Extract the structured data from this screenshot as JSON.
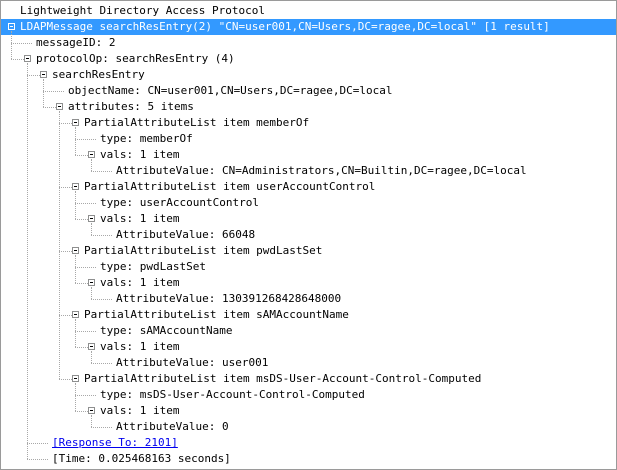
{
  "tree": {
    "rows": [
      {
        "text": "Lightweight Directory Access Protocol",
        "depth": 0,
        "expander": false,
        "selected": false,
        "link": false,
        "interactable": true
      },
      {
        "text": "LDAPMessage searchResEntry(2) \"CN=user001,CN=Users,DC=ragee,DC=local\" [1 result]",
        "depth": 0,
        "expander": true,
        "selected": true,
        "link": false,
        "interactable": true
      },
      {
        "text": "messageID: 2",
        "depth": 1,
        "expander": false,
        "selected": false,
        "link": false,
        "interactable": true
      },
      {
        "text": "protocolOp: searchResEntry (4)",
        "depth": 1,
        "expander": true,
        "selected": false,
        "link": false,
        "interactable": true
      },
      {
        "text": "searchResEntry",
        "depth": 2,
        "expander": true,
        "selected": false,
        "link": false,
        "interactable": true
      },
      {
        "text": "objectName: CN=user001,CN=Users,DC=ragee,DC=local",
        "depth": 3,
        "expander": false,
        "selected": false,
        "link": false,
        "interactable": true
      },
      {
        "text": "attributes: 5 items",
        "depth": 3,
        "expander": true,
        "selected": false,
        "link": false,
        "interactable": true
      },
      {
        "text": "PartialAttributeList item memberOf",
        "depth": 4,
        "expander": true,
        "selected": false,
        "link": false,
        "interactable": true
      },
      {
        "text": "type: memberOf",
        "depth": 5,
        "expander": false,
        "selected": false,
        "link": false,
        "interactable": true
      },
      {
        "text": "vals: 1 item",
        "depth": 5,
        "expander": true,
        "selected": false,
        "link": false,
        "interactable": true
      },
      {
        "text": "AttributeValue: CN=Administrators,CN=Builtin,DC=ragee,DC=local",
        "depth": 6,
        "expander": false,
        "selected": false,
        "link": false,
        "interactable": true
      },
      {
        "text": "PartialAttributeList item userAccountControl",
        "depth": 4,
        "expander": true,
        "selected": false,
        "link": false,
        "interactable": true
      },
      {
        "text": "type: userAccountControl",
        "depth": 5,
        "expander": false,
        "selected": false,
        "link": false,
        "interactable": true
      },
      {
        "text": "vals: 1 item",
        "depth": 5,
        "expander": true,
        "selected": false,
        "link": false,
        "interactable": true
      },
      {
        "text": "AttributeValue: 66048",
        "depth": 6,
        "expander": false,
        "selected": false,
        "link": false,
        "interactable": true
      },
      {
        "text": "PartialAttributeList item pwdLastSet",
        "depth": 4,
        "expander": true,
        "selected": false,
        "link": false,
        "interactable": true
      },
      {
        "text": "type: pwdLastSet",
        "depth": 5,
        "expander": false,
        "selected": false,
        "link": false,
        "interactable": true
      },
      {
        "text": "vals: 1 item",
        "depth": 5,
        "expander": true,
        "selected": false,
        "link": false,
        "interactable": true
      },
      {
        "text": "AttributeValue: 130391268428648000",
        "depth": 6,
        "expander": false,
        "selected": false,
        "link": false,
        "interactable": true
      },
      {
        "text": "PartialAttributeList item sAMAccountName",
        "depth": 4,
        "expander": true,
        "selected": false,
        "link": false,
        "interactable": true
      },
      {
        "text": "type: sAMAccountName",
        "depth": 5,
        "expander": false,
        "selected": false,
        "link": false,
        "interactable": true
      },
      {
        "text": "vals: 1 item",
        "depth": 5,
        "expander": true,
        "selected": false,
        "link": false,
        "interactable": true
      },
      {
        "text": "AttributeValue: user001",
        "depth": 6,
        "expander": false,
        "selected": false,
        "link": false,
        "interactable": true
      },
      {
        "text": "PartialAttributeList item msDS-User-Account-Control-Computed",
        "depth": 4,
        "expander": true,
        "selected": false,
        "link": false,
        "interactable": true
      },
      {
        "text": "type: msDS-User-Account-Control-Computed",
        "depth": 5,
        "expander": false,
        "selected": false,
        "link": false,
        "interactable": true
      },
      {
        "text": "vals: 1 item",
        "depth": 5,
        "expander": true,
        "selected": false,
        "link": false,
        "interactable": true
      },
      {
        "text": "AttributeValue: 0",
        "depth": 6,
        "expander": false,
        "selected": false,
        "link": false,
        "interactable": true
      },
      {
        "text": "[Response To: 2101]",
        "depth": 2,
        "expander": false,
        "selected": false,
        "link": true,
        "interactable": true
      },
      {
        "text": "[Time: 0.025468163 seconds]",
        "depth": 2,
        "expander": false,
        "selected": false,
        "link": false,
        "interactable": true
      }
    ]
  },
  "colors": {
    "selection": "#3399ff",
    "link": "#0000ee",
    "border": "#9a9a9a",
    "guide": "#a8a8a8"
  },
  "icons": {
    "collapse": "minus-box-icon"
  }
}
